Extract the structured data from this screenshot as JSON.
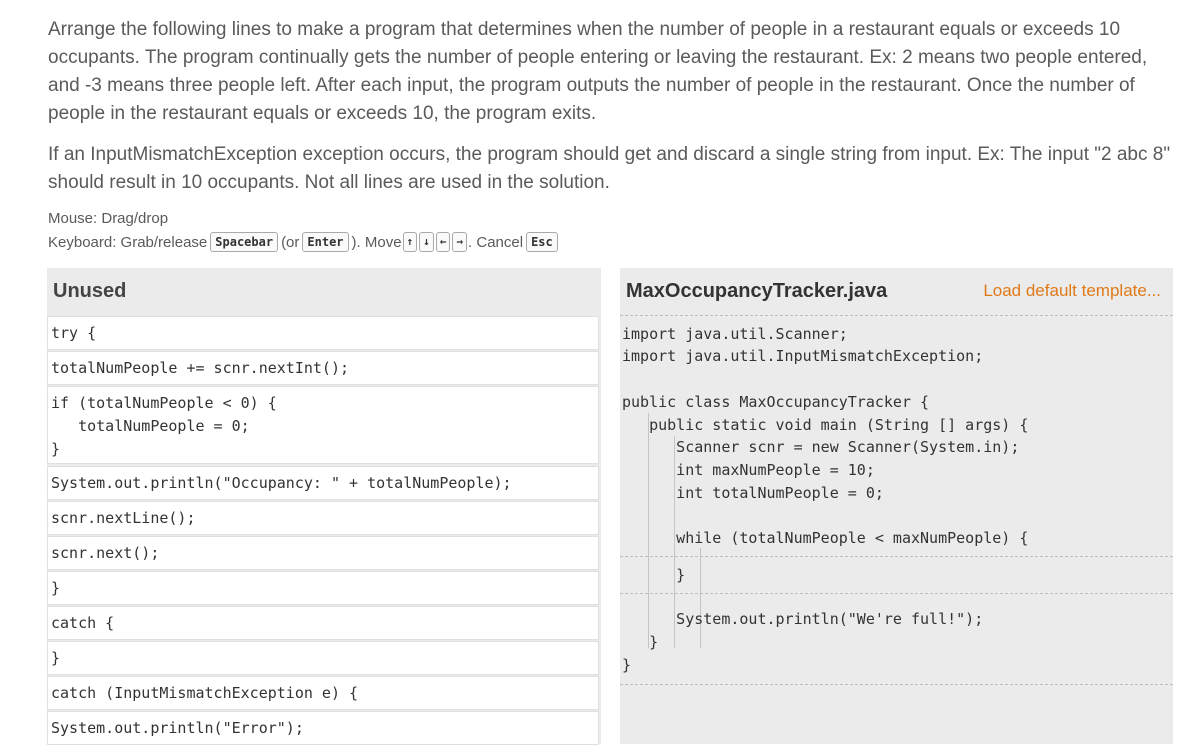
{
  "instructions": {
    "p1": "Arrange the following lines to make a program that determines when the number of people in a restaurant equals or exceeds 10 occupants. The program continually gets the number of people entering or leaving the restaurant. Ex: 2 means two people entered, and -3 means three people left. After each input, the program outputs the number of people in the restaurant. Once the number of people in the restaurant equals or exceeds 10, the program exits.",
    "p2": "If an InputMismatchException exception occurs, the program should get and discard a single string from input. Ex: The input \"2 abc 8\" should result in 10 occupants. Not all lines are used in the solution."
  },
  "help": {
    "mouse": "Mouse: Drag/drop",
    "keyboard_prefix": "Keyboard: Grab/release",
    "key_space": "Spacebar",
    "or_open": "(or",
    "key_enter": "Enter",
    "close_move": "). Move",
    "arrows": [
      "↑",
      "↓",
      "←",
      "→"
    ],
    "cancel": ". Cancel",
    "key_esc": "Esc"
  },
  "unused": {
    "title": "Unused",
    "blocks": [
      {
        "lines": [
          "try {"
        ]
      },
      {
        "lines": [
          "totalNumPeople += scnr.nextInt();"
        ]
      },
      {
        "lines": [
          "if (totalNumPeople < 0) {",
          "   totalNumPeople = 0;",
          "}"
        ]
      },
      {
        "lines": [
          "System.out.println(\"Occupancy: \" + totalNumPeople);"
        ]
      },
      {
        "lines": [
          "scnr.nextLine();"
        ]
      },
      {
        "lines": [
          "scnr.next();"
        ]
      },
      {
        "lines": [
          "}"
        ]
      },
      {
        "lines": [
          "catch {"
        ]
      },
      {
        "lines": [
          "}"
        ]
      },
      {
        "lines": [
          "catch (InputMismatchException e) {"
        ]
      },
      {
        "lines": [
          "System.out.println(\"Error\");"
        ]
      }
    ]
  },
  "editor": {
    "filename": "MaxOccupancyTracker.java",
    "load_default": "Load default template...",
    "lines": [
      "import java.util.Scanner;",
      "import java.util.InputMismatchException;",
      "public class MaxOccupancyTracker {",
      "   public static void main (String [] args) {",
      "      Scanner scnr = new Scanner(System.in);",
      "      int maxNumPeople = 10;",
      "      int totalNumPeople = 0;",
      "      while (totalNumPeople < maxNumPeople) {",
      "      }",
      "      System.out.println(\"We're full!\");",
      "   }",
      "}"
    ]
  }
}
